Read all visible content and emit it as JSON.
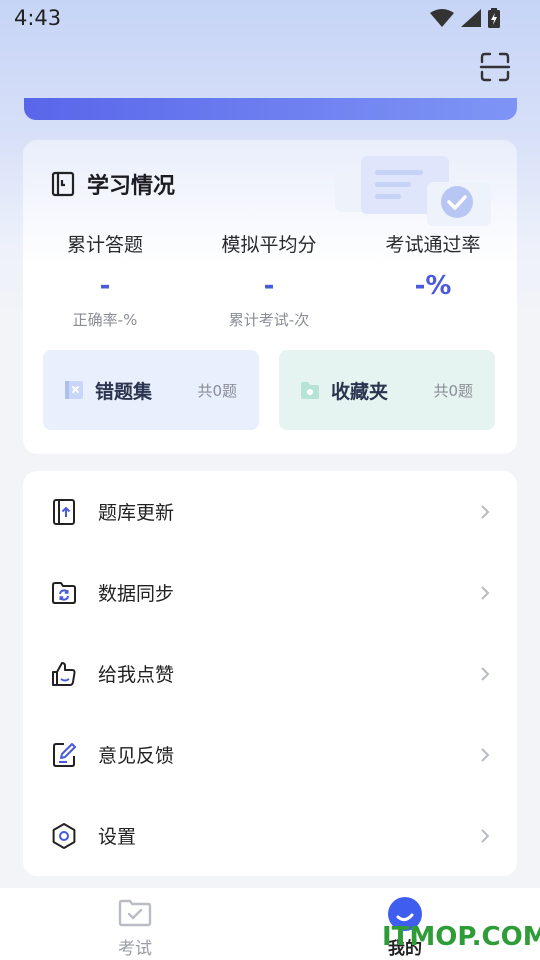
{
  "status_bar": {
    "time": "4:43"
  },
  "header": {
    "scan_icon": "scan-icon"
  },
  "study": {
    "title": "学习情况",
    "stats": [
      {
        "label": "累计答题",
        "value": "-",
        "sub": "正确率-%"
      },
      {
        "label": "模拟平均分",
        "value": "-",
        "sub": "累计考试-次"
      },
      {
        "label": "考试通过率",
        "value": "-%",
        "sub": ""
      }
    ],
    "wrong_set": {
      "title": "错题集",
      "count": "共0题"
    },
    "favorites": {
      "title": "收藏夹",
      "count": "共0题"
    }
  },
  "menu": {
    "items": [
      {
        "label": "题库更新",
        "icon": "book-upload-icon"
      },
      {
        "label": "数据同步",
        "icon": "folder-sync-icon"
      },
      {
        "label": "给我点赞",
        "icon": "thumbs-up-icon"
      },
      {
        "label": "意见反馈",
        "icon": "edit-feedback-icon"
      },
      {
        "label": "设置",
        "icon": "settings-icon"
      }
    ]
  },
  "tabbar": {
    "tabs": [
      {
        "label": "考试",
        "icon": "exam-icon",
        "active": false
      },
      {
        "label": "我的",
        "icon": "profile-icon",
        "active": true
      }
    ]
  },
  "watermark": "ITMOP.COM",
  "colors": {
    "accent": "#4a5ade",
    "banner_start": "#5966ea",
    "banner_end": "#7f95f5",
    "wrong_bg": "#e8effd",
    "fav_bg": "#e5f4f0",
    "watermark": "#2f9d37"
  }
}
